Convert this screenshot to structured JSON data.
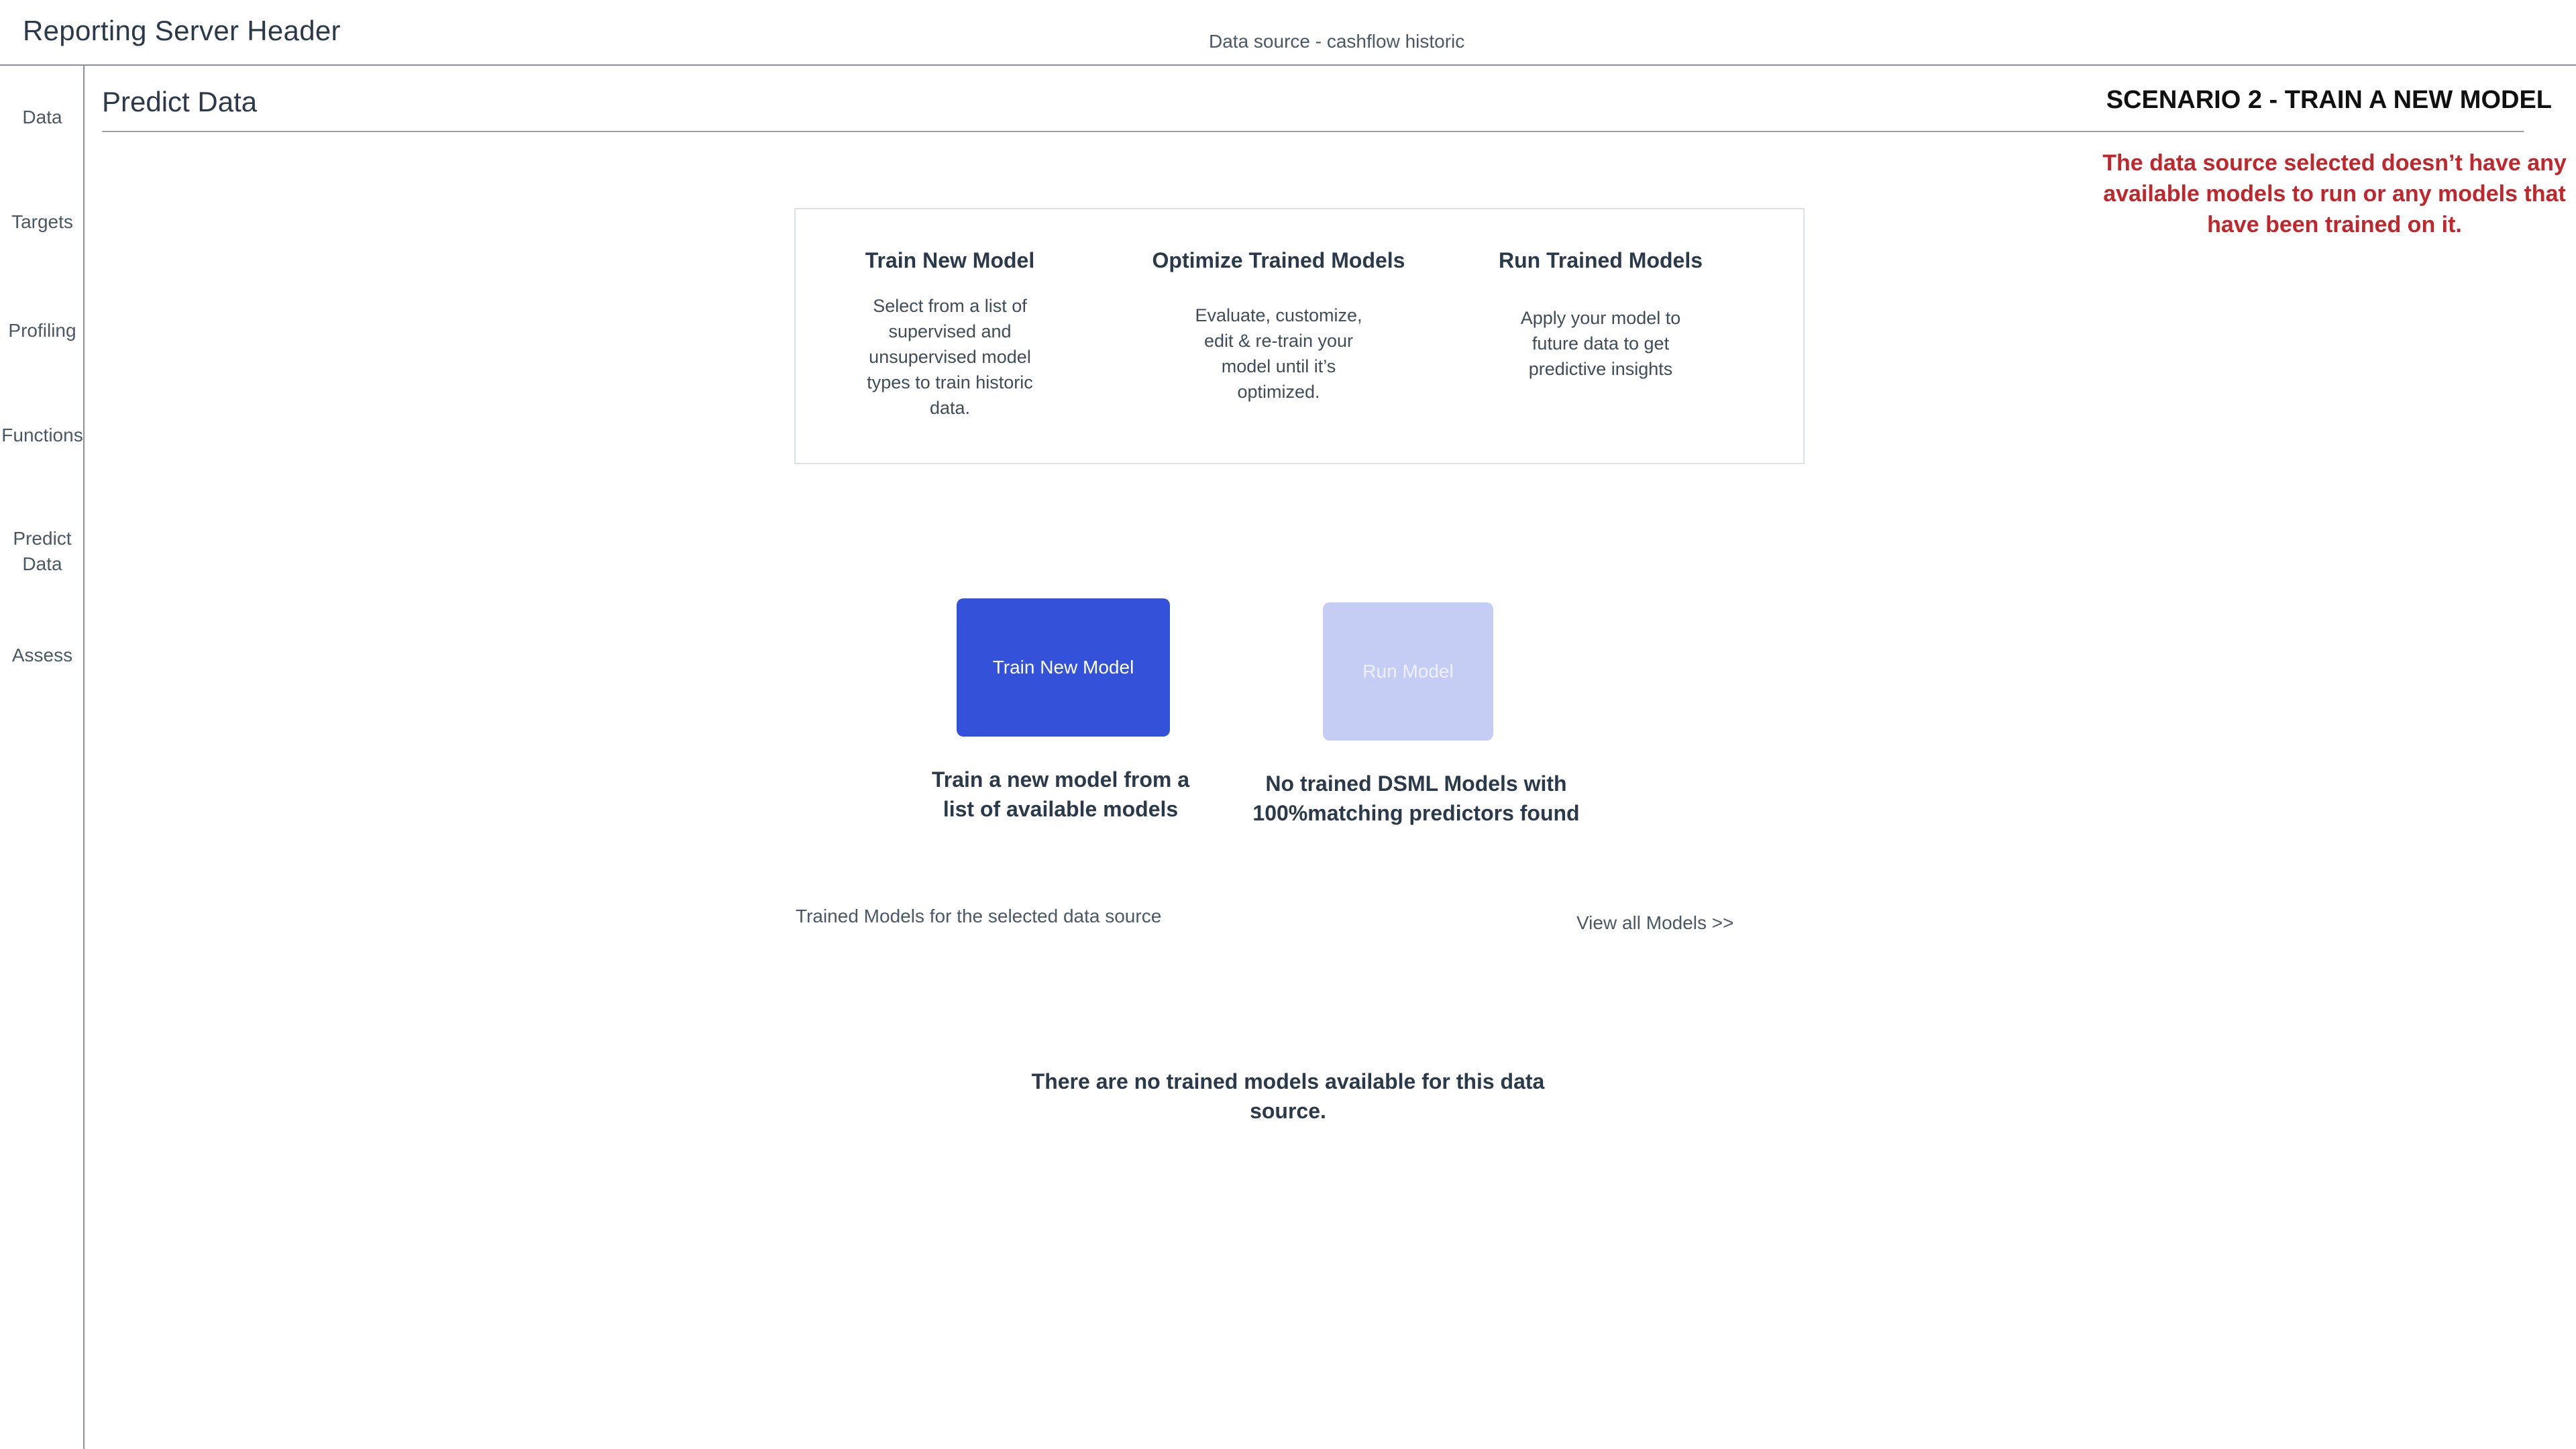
{
  "header": {
    "title": "Reporting Server Header",
    "data_source": "Data source - cashflow historic"
  },
  "sidebar": {
    "items": [
      {
        "label": "Data"
      },
      {
        "label": "Targets"
      },
      {
        "label": "Profiling"
      },
      {
        "label": "Functions"
      },
      {
        "label": "Predict\nData"
      },
      {
        "label": "Assess"
      }
    ]
  },
  "page": {
    "title": "Predict Data",
    "scenario": "SCENARIO 2 - TRAIN A NEW MODEL",
    "scenario_note": "The data source selected doesn’t have any available models to run or any models that have been trained on it."
  },
  "info_card": {
    "columns": [
      {
        "title": "Train New Model",
        "description": "Select from a list of supervised and unsupervised model types to train historic data."
      },
      {
        "title": "Optimize Trained Models",
        "description": "Evaluate, customize, edit & re-train your model until it’s optimized."
      },
      {
        "title": "Run Trained Models",
        "description": "Apply your model to future data to get predictive insights"
      }
    ]
  },
  "actions": {
    "train_button": "Train New Model",
    "run_button": "Run Model",
    "train_caption": "Train a new model from a list of available models",
    "run_caption": "No trained DSML Models with 100%matching predictors found"
  },
  "trained_models": {
    "label": "Trained Models for the selected data source",
    "view_all": "View all Models >>",
    "empty_message": "There are no trained models available for this data source."
  }
}
